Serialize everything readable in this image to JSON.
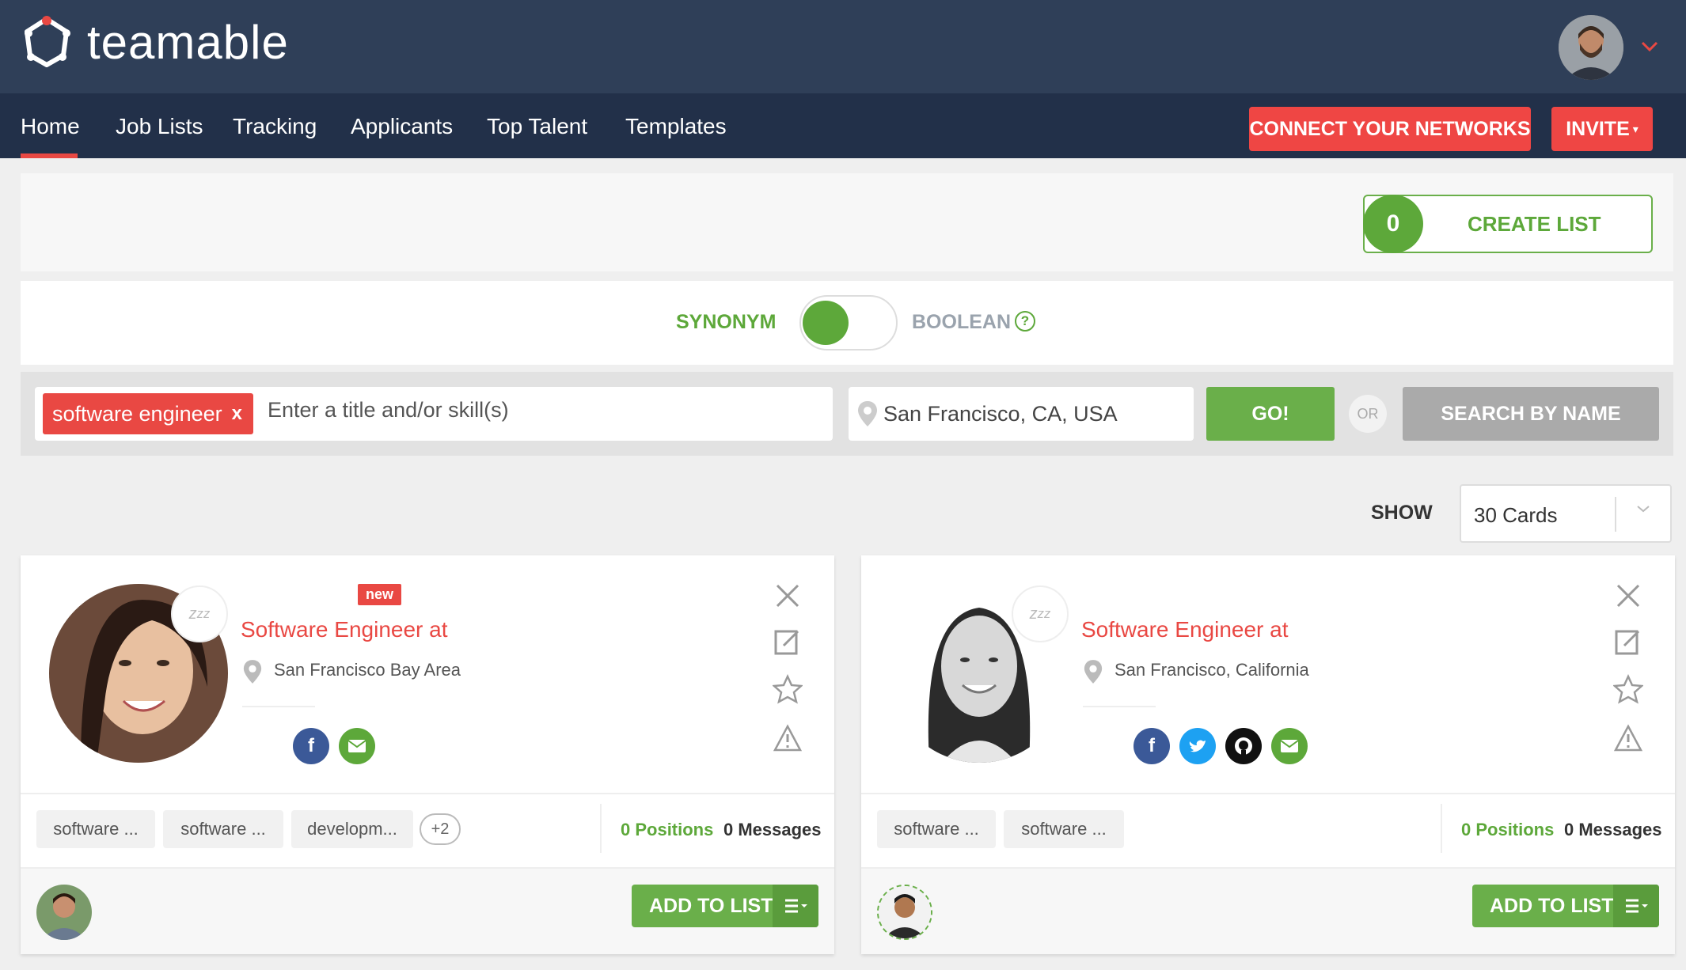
{
  "app": {
    "name": "teamable"
  },
  "nav": {
    "items": [
      "Home",
      "Job Lists",
      "Tracking",
      "Applicants",
      "Top Talent",
      "Templates"
    ],
    "active": "Home",
    "connect_label": "CONNECT YOUR NETWORKS",
    "invite_label": "INVITE"
  },
  "lists": {
    "count": "0",
    "create_label": "CREATE LIST"
  },
  "search_mode": {
    "synonym_label": "SYNONYM",
    "boolean_label": "BOOLEAN",
    "help": "?",
    "selected": "SYNONYM"
  },
  "search": {
    "keyword_chip": "software engineer",
    "chip_remove": "x",
    "keyword_placeholder": "Enter a title and/or skill(s)",
    "location": "San Francisco, CA, USA",
    "go_label": "GO!",
    "or_label": "OR",
    "by_name_label": "SEARCH BY NAME"
  },
  "show": {
    "label": "SHOW",
    "value": "30 Cards"
  },
  "cards": [
    {
      "badge": "new",
      "title": "Software Engineer at",
      "location": "San Francisco Bay Area",
      "social": [
        "facebook",
        "email"
      ],
      "tags": [
        "software ...",
        "software ...",
        "developm..."
      ],
      "more_tags": "+2",
      "positions": "0 Positions",
      "messages": "0 Messages",
      "add_label": "ADD TO LIST"
    },
    {
      "title": "Software Engineer at",
      "location": "San Francisco, California",
      "social": [
        "facebook",
        "twitter",
        "github",
        "email"
      ],
      "tags": [
        "software ...",
        "software ..."
      ],
      "positions": "0 Positions",
      "messages": "0 Messages",
      "add_label": "ADD TO LIST"
    }
  ],
  "colors": {
    "brand_red": "#e94843",
    "green": "#5da83a",
    "header": "#2f3f58",
    "nav": "#223049"
  }
}
